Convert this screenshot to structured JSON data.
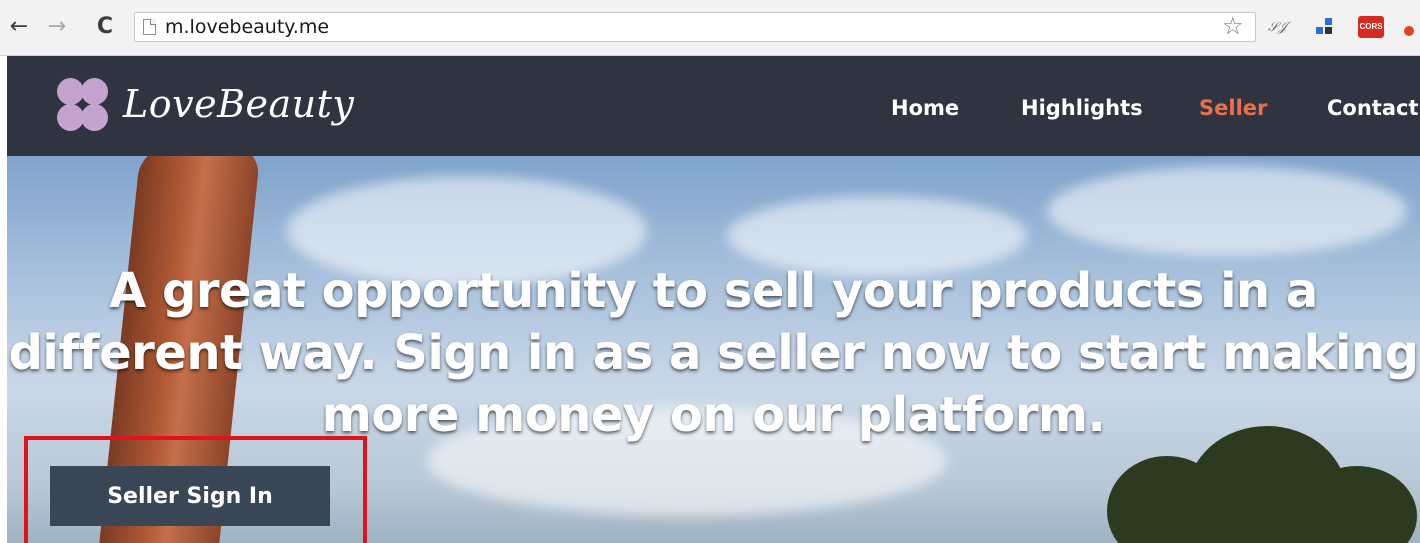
{
  "browser": {
    "url": "m.lovebeauty.me",
    "back_glyph": "←",
    "forward_glyph": "→",
    "reload_glyph": "C",
    "star_glyph": "☆",
    "ext_script_glyph": "𝒮𝒥",
    "ext_cors_label": "CORS"
  },
  "site": {
    "logo_text": "LoveBeauty",
    "logo_color": "#c5a3cf",
    "header_bg": "#2f3440",
    "nav": [
      {
        "label": "Home"
      },
      {
        "label": "Highlights"
      },
      {
        "label": "Seller",
        "active": true,
        "color": "#e8704a"
      },
      {
        "label": "Contact"
      }
    ]
  },
  "hero": {
    "headline": "A great opportunity to sell your products in a different way. Sign in as a seller now to start making more money on our platform.",
    "cta_label": "Seller Sign In",
    "cta_bg": "#384656",
    "highlight_color": "#e0121a"
  }
}
